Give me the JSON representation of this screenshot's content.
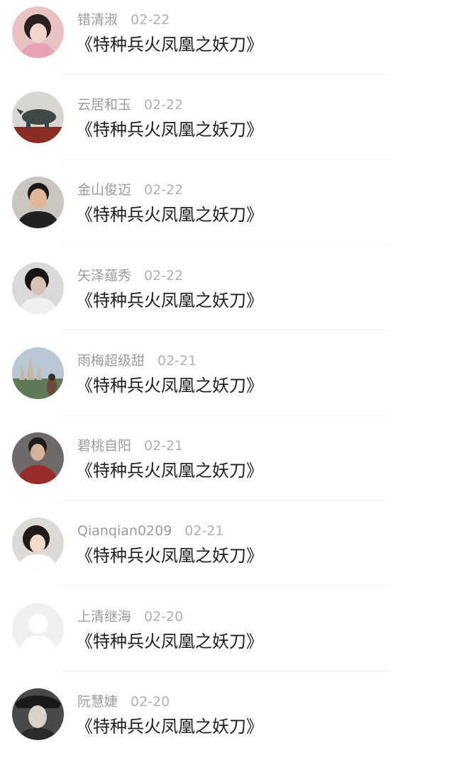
{
  "comments": [
    {
      "name": "错清淑",
      "date": "02-22",
      "title": "《特种兵火凤凰之妖刀》",
      "avatar": "portrait-woman-avatar"
    },
    {
      "name": "云居和玉",
      "date": "02-22",
      "title": "《特种兵火凤凰之妖刀》",
      "avatar": "rhino-statue-avatar"
    },
    {
      "name": "金山俊迈",
      "date": "02-22",
      "title": "《特种兵火凤凰之妖刀》",
      "avatar": "portrait-man-avatar"
    },
    {
      "name": "矢泽蕴秀",
      "date": "02-22",
      "title": "《特种兵火凤凰之妖刀》",
      "avatar": "portrait-man-avatar"
    },
    {
      "name": "雨梅超级甜",
      "date": "02-21",
      "title": "《特种兵火凤凰之妖刀》",
      "avatar": "castle-landscape-avatar"
    },
    {
      "name": "碧桃自阳",
      "date": "02-21",
      "title": "《特种兵火凤凰之妖刀》",
      "avatar": "portrait-man-avatar"
    },
    {
      "name": "Qianqian0209",
      "date": "02-21",
      "title": "《特种兵火凤凰之妖刀》",
      "avatar": "portrait-woman-avatar"
    },
    {
      "name": "上清继海",
      "date": "02-20",
      "title": "《特种兵火凤凰之妖刀》",
      "avatar": "default-user-avatar"
    },
    {
      "name": "阮慧婕",
      "date": "02-20",
      "title": "《特种兵火凤凰之妖刀》",
      "avatar": "portrait-woman-avatar"
    }
  ]
}
